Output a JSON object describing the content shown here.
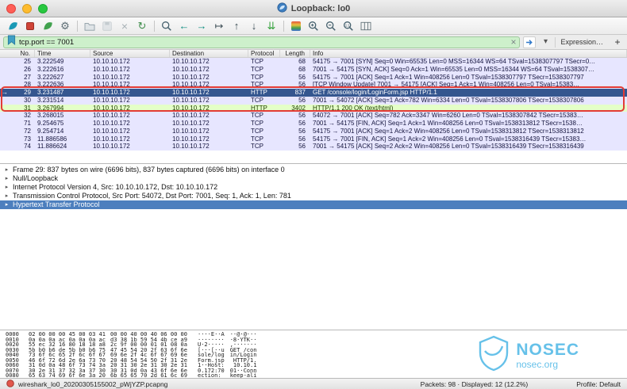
{
  "window": {
    "title": "Loopback: lo0"
  },
  "toolbar": {
    "buttons": [
      "start-capture",
      "stop-capture",
      "restart-capture",
      "capture-options",
      "sep",
      "open-file",
      "save-file",
      "close-file",
      "reload",
      "sep",
      "find-packet",
      "go-back",
      "go-forward",
      "go-to-packet",
      "go-first",
      "go-last",
      "auto-scroll",
      "sep",
      "colorize",
      "zoom-in",
      "zoom-out",
      "zoom-original",
      "resize-columns"
    ]
  },
  "filter_bar": {
    "value": "tcp.port == 7001",
    "expression_label": "Expression…",
    "add_label": "+"
  },
  "packet_list": {
    "columns": [
      "No.",
      "Time",
      "Source",
      "Destination",
      "Protocol",
      "Length",
      "Info"
    ],
    "rows": [
      {
        "no": "25",
        "time": "3.222549",
        "src": "10.10.10.172",
        "dst": "10.10.10.172",
        "proto": "TCP",
        "len": "68",
        "info": "54175 → 7001 [SYN] Seq=0 Win=65535 Len=0 MSS=16344 WS=64 TSval=1538307797 TSecr=0…",
        "color": "tcp",
        "marker": false
      },
      {
        "no": "26",
        "time": "3.222616",
        "src": "10.10.10.172",
        "dst": "10.10.10.172",
        "proto": "TCP",
        "len": "68",
        "info": "7001 → 54175 [SYN, ACK] Seq=0 Ack=1 Win=65535 Len=0 MSS=16344 WS=64 TSval=1538307…",
        "color": "tcp",
        "marker": false
      },
      {
        "no": "27",
        "time": "3.222627",
        "src": "10.10.10.172",
        "dst": "10.10.10.172",
        "proto": "TCP",
        "len": "56",
        "info": "54175 → 7001 [ACK] Seq=1 Ack=1 Win=408256 Len=0 TSval=1538307797 TSecr=1538307797",
        "color": "tcp",
        "marker": false
      },
      {
        "no": "28",
        "time": "3.222636",
        "src": "10.10.10.172",
        "dst": "10.10.10.172",
        "proto": "TCP",
        "len": "56",
        "info": "[TCP Window Update] 7001 → 54175 [ACK] Seq=1 Ack=1 Win=408256 Len=0 TSval=15383…",
        "color": "tcp",
        "marker": false
      },
      {
        "no": "29",
        "time": "3.231487",
        "src": "10.10.10.172",
        "dst": "10.10.10.172",
        "proto": "HTTP",
        "len": "837",
        "info": "GET /console/login/LoginForm.jsp HTTP/1.1",
        "color": "selected",
        "marker": true
      },
      {
        "no": "30",
        "time": "3.231514",
        "src": "10.10.10.172",
        "dst": "10.10.10.172",
        "proto": "TCP",
        "len": "56",
        "info": "7001 → 54072 [ACK] Seq=1 Ack=782 Win=6334 Len=0 TSval=1538307806 TSecr=1538307806",
        "color": "tcp",
        "marker": false
      },
      {
        "no": "31",
        "time": "3.267994",
        "src": "10.10.10.172",
        "dst": "10.10.10.172",
        "proto": "HTTP",
        "len": "3402",
        "info": "HTTP/1.1 200 OK  (text/html)",
        "color": "http",
        "marker": false
      },
      {
        "no": "32",
        "time": "3.268015",
        "src": "10.10.10.172",
        "dst": "10.10.10.172",
        "proto": "TCP",
        "len": "56",
        "info": "54072 → 7001 [ACK] Seq=782 Ack=3347 Win=6260 Len=0 TSval=1538307842 TSecr=15383…",
        "color": "tcp",
        "marker": false
      },
      {
        "no": "71",
        "time": "9.254675",
        "src": "10.10.10.172",
        "dst": "10.10.10.172",
        "proto": "TCP",
        "len": "56",
        "info": "7001 → 54175 [FIN, ACK] Seq=1 Ack=1 Win=408256 Len=0 TSval=1538313812 TSecr=1538…",
        "color": "tcp",
        "marker": false
      },
      {
        "no": "72",
        "time": "9.254714",
        "src": "10.10.10.172",
        "dst": "10.10.10.172",
        "proto": "TCP",
        "len": "56",
        "info": "54175 → 7001 [ACK] Seq=1 Ack=2 Win=408256 Len=0 TSval=1538313812 TSecr=1538313812",
        "color": "tcp",
        "marker": false
      },
      {
        "no": "73",
        "time": "11.886586",
        "src": "10.10.10.172",
        "dst": "10.10.10.172",
        "proto": "TCP",
        "len": "56",
        "info": "54175 → 7001 [FIN, ACK] Seq=1 Ack=2 Win=408256 Len=0 TSval=1538316439 TSecr=15383…",
        "color": "tcp",
        "marker": false
      },
      {
        "no": "74",
        "time": "11.886624",
        "src": "10.10.10.172",
        "dst": "10.10.10.172",
        "proto": "TCP",
        "len": "56",
        "info": "7001 → 54175 [ACK] Seq=2 Ack=2 Win=408256 Len=0 TSval=1538316439 TSecr=1538316439",
        "color": "tcp",
        "marker": false
      }
    ]
  },
  "details": {
    "rows": [
      {
        "text": "Frame 29: 837 bytes on wire (6696 bits), 837 bytes captured (6696 bits) on interface 0",
        "selected": false
      },
      {
        "text": "Null/Loopback",
        "selected": false
      },
      {
        "text": "Internet Protocol Version 4, Src: 10.10.10.172, Dst: 10.10.10.172",
        "selected": false
      },
      {
        "text": "Transmission Control Protocol, Src Port: 54072, Dst Port: 7001, Seq: 1, Ack: 1, Len: 781",
        "selected": false
      },
      {
        "text": "Hypertext Transfer Protocol",
        "selected": true
      }
    ]
  },
  "hex_view": {
    "lines": [
      {
        "offset": "0000",
        "hex1": "02 00 00 00 45 00 03 41",
        "hex2": "00 00 40 00 40 06 00 00",
        "ascii1": "····E··A",
        "ascii2": "··@·@···"
      },
      {
        "offset": "0010",
        "hex1": "0a 0a 0a ac 0a 0a 0a ac",
        "hex2": "d3 38 1b 59 54 4b ce a9",
        "ascii1": "········",
        "ascii2": "·8·YTK··"
      },
      {
        "offset": "0020",
        "hex1": "55 ec 32 16 80 18 18 a8",
        "hex2": "2c 9f 00 00 01 01 08 0a",
        "ascii1": "U·2·····",
        "ascii2": ",·······"
      },
      {
        "offset": "0030",
        "hex1": "5b b0 b6 de 5b b0 b6 75",
        "hex2": "47 45 54 20 2f 63 6f 6e",
        "ascii1": "[···[··u",
        "ascii2": "GET /con"
      },
      {
        "offset": "0040",
        "hex1": "73 6f 6c 65 2f 6c 6f 67",
        "hex2": "69 6e 2f 4c 6f 67 69 6e",
        "ascii1": "sole/log",
        "ascii2": "in/Login"
      },
      {
        "offset": "0050",
        "hex1": "46 6f 72 6d 2e 6a 73 70",
        "hex2": "20 48 54 54 50 2f 31 2e",
        "ascii1": "Form.jsp",
        "ascii2": " HTTP/1."
      },
      {
        "offset": "0060",
        "hex1": "31 0d 0a 48 6f 73 74 3a",
        "hex2": "20 31 30 2e 31 30 2e 31",
        "ascii1": "1··Host:",
        "ascii2": " 10.10.1"
      },
      {
        "offset": "0070",
        "hex1": "30 2e 31 37 32 3a 37 30",
        "hex2": "30 31 0d 0a 43 6f 6e 6e",
        "ascii1": "0.172:70",
        "ascii2": "01··Conn"
      },
      {
        "offset": "0080",
        "hex1": "65 63 74 69 6f 6e 3a 20",
        "hex2": "6b 65 65 70 2d 61 6c 69",
        "ascii1": "ection: ",
        "ascii2": "keep-ali"
      }
    ]
  },
  "status_bar": {
    "file": "wireshark_lo0_20200305155002_pWjYZP.pcapng",
    "counts": "Packets: 98 · Displayed: 12 (12.2%)",
    "profile": "Profile: Default"
  },
  "watermark": {
    "brand": "NOSEC",
    "domain": "nosec.org"
  },
  "misc_icons": [
    "wireshark-app-icon",
    "filter-bookmark-icon",
    "filter-clear-icon",
    "apply-filter-icon",
    "filter-dropdown-icon",
    "expert-info-icon",
    "expand-arrow-icon",
    "selected-packet-arrow-icon",
    "nosec-shield-icon",
    "close-window-button",
    "minimize-window-button",
    "zoom-window-button"
  ],
  "colors": {
    "filter_valid_bg": "#cdf0cb",
    "tcp_row_bg": "#e7e6ff",
    "http_row_bg": "#e4ffc7",
    "selected_row_bg": "#35568f",
    "selected_detail_bg": "#4d7fbe",
    "annotation_red": "#e33b35",
    "watermark_blue": "#41b2e4"
  }
}
